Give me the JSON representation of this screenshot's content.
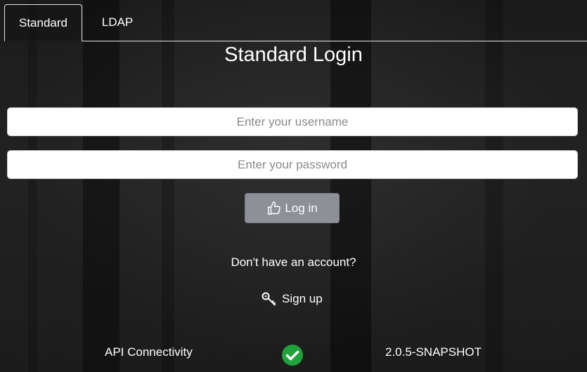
{
  "tabs": [
    {
      "label": "Standard",
      "active": true
    },
    {
      "label": "LDAP",
      "active": false
    }
  ],
  "title": "Standard Login",
  "form": {
    "username_placeholder": "Enter your username",
    "username_value": "",
    "password_placeholder": "Enter your password",
    "password_value": "",
    "login_label": "Log in",
    "login_icon": "thumbs-up-icon"
  },
  "signup": {
    "prompt": "Don't have an account?",
    "label": "Sign up",
    "icon": "key-icon"
  },
  "footer": {
    "status_label": "API Connectivity",
    "status_icon": "check-circle-icon",
    "status_color": "#1fa33a",
    "version": "2.0.5-SNAPSHOT"
  },
  "colors": {
    "button": "#8d9096",
    "background": "#1f1f1f"
  }
}
